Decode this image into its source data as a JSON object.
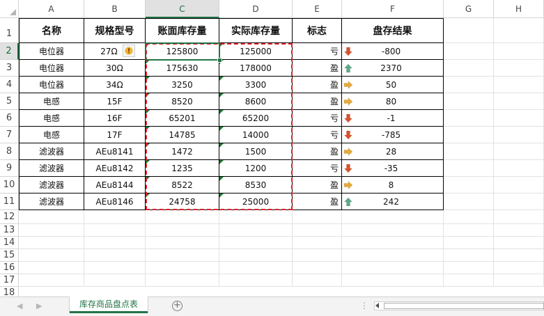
{
  "columns": [
    "A",
    "B",
    "C",
    "D",
    "E",
    "F",
    "G",
    "H"
  ],
  "rows": [
    "1",
    "2",
    "3",
    "4",
    "5",
    "6",
    "7",
    "8",
    "9",
    "10",
    "11",
    "12",
    "13",
    "14",
    "15",
    "16",
    "17",
    "18"
  ],
  "headers": [
    "名称",
    "规格型号",
    "账面库存量",
    "实际库存量",
    "标志",
    "盘存结果"
  ],
  "data": [
    {
      "name": "电位器",
      "spec": "27Ω",
      "book": "125800",
      "actual": "125000",
      "flag": "亏",
      "icon": "arrow-down-icon",
      "result": "-800"
    },
    {
      "name": "电位器",
      "spec": "30Ω",
      "book": "175630",
      "actual": "178000",
      "flag": "盈",
      "icon": "arrow-up-icon",
      "result": "2370"
    },
    {
      "name": "电位器",
      "spec": "34Ω",
      "book": "3250",
      "actual": "3300",
      "flag": "盈",
      "icon": "arrow-right-icon",
      "result": "50"
    },
    {
      "name": "电感",
      "spec": "15F",
      "book": "8520",
      "actual": "8600",
      "flag": "盈",
      "icon": "arrow-right-icon",
      "result": "80"
    },
    {
      "name": "电感",
      "spec": "16F",
      "book": "65201",
      "actual": "65200",
      "flag": "亏",
      "icon": "arrow-down-icon",
      "result": "-1"
    },
    {
      "name": "电感",
      "spec": "17F",
      "book": "14785",
      "actual": "14000",
      "flag": "亏",
      "icon": "arrow-down-icon",
      "result": "-785"
    },
    {
      "name": "滤波器",
      "spec": "AEu8141",
      "book": "1472",
      "actual": "1500",
      "flag": "盈",
      "icon": "arrow-right-icon",
      "result": "28"
    },
    {
      "name": "滤波器",
      "spec": "AEu8142",
      "book": "1235",
      "actual": "1200",
      "flag": "亏",
      "icon": "arrow-down-icon",
      "result": "-35"
    },
    {
      "name": "滤波器",
      "spec": "AEu8144",
      "book": "8522",
      "actual": "8530",
      "flag": "盈",
      "icon": "arrow-right-icon",
      "result": "8"
    },
    {
      "name": "滤波器",
      "spec": "AEu8146",
      "book": "24758",
      "actual": "25000",
      "flag": "盈",
      "icon": "arrow-up-icon",
      "result": "242"
    }
  ],
  "sheet_tab": "库存商品盘点表",
  "add_sheet": "+",
  "scroll_dots": "⋮",
  "nav_prev": "◀",
  "nav_next": "▶",
  "selected_cell": "C2",
  "colors": {
    "accent": "#217346",
    "down": "#d9522b",
    "up": "#5fa88a",
    "right": "#e5a93c",
    "copy_marquee": "#e0202a",
    "error_flag": "#1a7a32"
  }
}
